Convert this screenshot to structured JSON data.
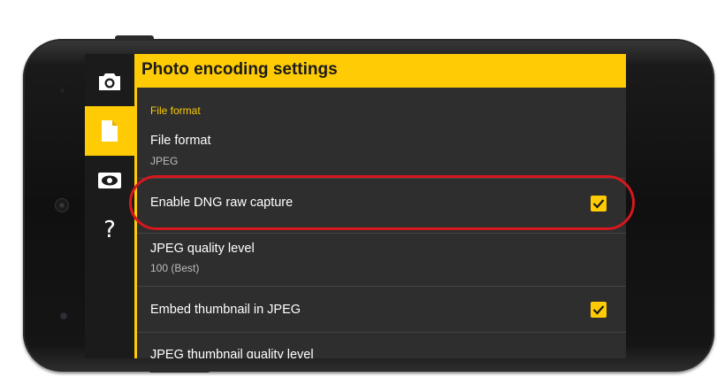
{
  "header": {
    "title": "Photo encoding settings"
  },
  "sidebar": {
    "items": [
      {
        "icon": "camera-icon",
        "active": false
      },
      {
        "icon": "file-icon",
        "active": true
      },
      {
        "icon": "eye-icon",
        "active": false
      },
      {
        "icon": "help-icon",
        "label": "?",
        "active": false
      }
    ]
  },
  "settings": {
    "section_label": "File format",
    "file_format": {
      "title": "File format",
      "value": "JPEG"
    },
    "dng_raw": {
      "title": "Enable DNG raw capture",
      "checked": true
    },
    "jpeg_quality": {
      "title": "JPEG quality level",
      "value": "100 (Best)"
    },
    "embed_thumbnail": {
      "title": "Embed thumbnail in JPEG",
      "checked": true
    },
    "thumbnail_quality": {
      "title": "JPEG thumbnail quality level"
    }
  },
  "colors": {
    "accent": "#ffcb05",
    "highlight": "#d6171d",
    "background": "#2e2e2e"
  }
}
